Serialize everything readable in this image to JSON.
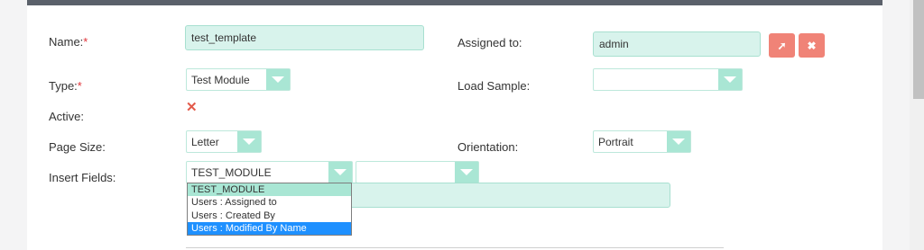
{
  "labels": {
    "name": "Name:",
    "type": "Type:",
    "active": "Active:",
    "page_size": "Page Size:",
    "insert_fields": "Insert Fields:",
    "assigned_to": "Assigned to:",
    "load_sample": "Load Sample:",
    "orientation": "Orientation:",
    "required_mark": "*"
  },
  "fields": {
    "name_value": "test_template",
    "assigned_value": "admin",
    "type_value": "Test Module",
    "load_sample_value": "",
    "page_size_value": "Letter",
    "orientation_value": "Portrait",
    "insert_module_value": "TEST_MODULE",
    "insert_field_value": "",
    "active_mark": "✕"
  },
  "buttons": {
    "select_glyph": "➚",
    "clear_glyph": "✖"
  },
  "insert_dropdown": {
    "options": [
      "TEST_MODULE",
      "Users : Assigned to",
      "Users : Created By",
      "Users : Modified By Name"
    ]
  },
  "colors": {
    "field_bg": "#d8f3ec",
    "accent": "#a9e6d4",
    "danger": "#f08377",
    "selection": "#1e90ff"
  }
}
